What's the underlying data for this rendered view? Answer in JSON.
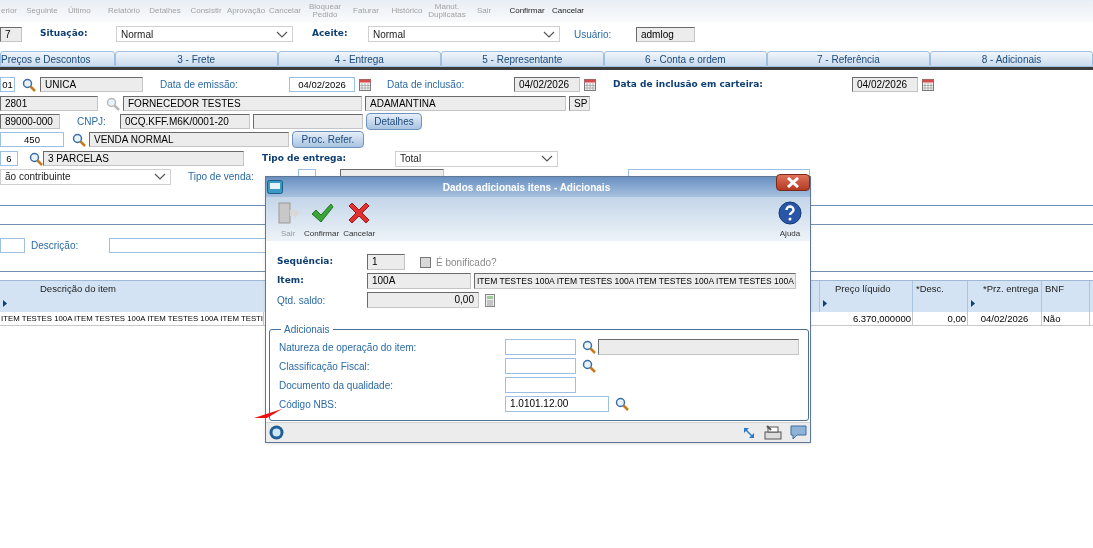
{
  "toolbar": [
    {
      "label": "erior",
      "disabled": true
    },
    {
      "label": "Seguinte",
      "disabled": true
    },
    {
      "label": "Último",
      "disabled": true
    },
    {
      "label": "Relatório",
      "disabled": true
    },
    {
      "label": "Detalhes",
      "disabled": true
    },
    {
      "label": "Consistir",
      "disabled": true
    },
    {
      "label": "Aprovação",
      "disabled": true
    },
    {
      "label": "Cancelar",
      "disabled": true
    },
    {
      "label": "Bloquear Pedido",
      "disabled": true
    },
    {
      "label": "Faturar",
      "disabled": true
    },
    {
      "label": "Histórico",
      "disabled": true
    },
    {
      "label": "Manut. Duplicatas",
      "disabled": true
    },
    {
      "label": "Sair",
      "disabled": true
    },
    {
      "label": "Confirmar",
      "disabled": false
    },
    {
      "label": "Cancelar",
      "disabled": false
    }
  ],
  "header_row": [
    {
      "kind": "readonly",
      "value": "7"
    },
    {
      "kind": "label_bold",
      "text": "Situação:"
    },
    {
      "kind": "select",
      "value": "Normal"
    },
    {
      "kind": "label_bold",
      "text": "Aceite:"
    },
    {
      "kind": "select",
      "value": "Normal"
    },
    {
      "kind": "label",
      "text": "Usuário:"
    },
    {
      "kind": "readonly",
      "value": "admlog"
    }
  ],
  "tabs": [
    {
      "label": "Preços e Descontos",
      "selected": false
    },
    {
      "label": "3 - Frete",
      "selected": false
    },
    {
      "label": "4 - Entrega",
      "selected": false
    },
    {
      "label": "5 - Representante",
      "selected": false
    },
    {
      "label": "6 - Conta e ordem",
      "selected": false
    },
    {
      "label": "7 - Referência",
      "selected": false
    },
    {
      "label": "8 - Adicionais",
      "selected": false
    }
  ],
  "form_rows": [
    [
      {
        "kind": "input",
        "value": "01"
      },
      {
        "kind": "search",
        "disabled": false
      },
      {
        "kind": "readonly",
        "value": "UNICA"
      },
      {
        "kind": "label",
        "text": "Data de emissão:"
      },
      {
        "kind": "input",
        "value": "04/02/2026"
      },
      {
        "kind": "calendar"
      },
      {
        "kind": "label",
        "text": "Data de inclusão:"
      },
      {
        "kind": "readonly",
        "value": "04/02/2026"
      },
      {
        "kind": "calendar"
      },
      {
        "kind": "label_bold",
        "text": "Data de inclusão em carteira:"
      },
      {
        "kind": "readonly",
        "value": "04/02/2026"
      },
      {
        "kind": "calendar"
      }
    ],
    [
      {
        "kind": "readonly",
        "value": "2801"
      },
      {
        "kind": "search",
        "disabled": true
      },
      {
        "kind": "readonly",
        "value": "FORNECEDOR TESTES"
      },
      {
        "kind": "readonly",
        "value": "ADAMANTINA"
      },
      {
        "kind": "readonly",
        "value": "SP"
      }
    ],
    [
      {
        "kind": "readonly",
        "value": "89000-000"
      },
      {
        "kind": "label",
        "text": "CNPJ:"
      },
      {
        "kind": "readonly",
        "value": "0CQ.KFF.M6K/0001-20"
      },
      {
        "kind": "readonly"
      },
      {
        "kind": "button",
        "text": "Detalhes"
      }
    ],
    [
      {
        "kind": "input",
        "value": "450"
      },
      {
        "kind": "search",
        "disabled": false
      },
      {
        "kind": "readonly",
        "value": "VENDA NORMAL"
      },
      {
        "kind": "button",
        "text": "Proc. Refer."
      }
    ],
    [
      {
        "kind": "input",
        "value": "6"
      },
      {
        "kind": "search",
        "disabled": false
      },
      {
        "kind": "readonly",
        "value": "3 PARCELAS"
      },
      {
        "kind": "label_bold",
        "text": "Tipo de entrega:"
      },
      {
        "kind": "select",
        "value": "Total"
      }
    ],
    [
      {
        "kind": "select",
        "value": "ão contribuinte"
      },
      {
        "kind": "label",
        "text": "Tipo de venda:"
      },
      {
        "kind": "input"
      },
      {
        "kind": "readonly"
      },
      {
        "kind": "input"
      }
    ]
  ],
  "filter_row": [
    {
      "kind": "input"
    },
    {
      "kind": "label",
      "text": "Descrição:"
    },
    {
      "kind": "input"
    }
  ],
  "table": {
    "columns": [
      {
        "label": "Descrição do item",
        "marker": true
      },
      {
        "label": "Preço líquido",
        "marker": true
      },
      {
        "label": "*Desc.",
        "marker": false
      },
      {
        "label": "*Prz. entrega",
        "marker": true
      },
      {
        "label": "BNF",
        "marker": false
      }
    ],
    "rows": [
      [
        "ITEM TESTES 100A ITEM TESTES 100A ITEM TESTES 100A ITEM TESTI",
        "6.370,000000",
        "0,00",
        "04/02/2026",
        "Não"
      ]
    ]
  },
  "dialog": {
    "title": "Dados adicionais itens - Adicionais",
    "toolbar": [
      {
        "kind": "exit",
        "label": "Sair",
        "disabled": true
      },
      {
        "kind": "confirm",
        "label": "Confirmar",
        "disabled": false
      },
      {
        "kind": "cancel",
        "label": "Cancelar",
        "disabled": false
      }
    ],
    "help": {
      "label": "Ajuda"
    },
    "sequencia": {
      "label": "Sequência:",
      "value": "1"
    },
    "bonificado": {
      "label": "É bonificado?",
      "checked": false
    },
    "item": {
      "label": "Item:",
      "code": "100A",
      "description": "ITEM TESTES 100A ITEM TESTES 100A ITEM TESTES 100A ITEM TESTES 100A"
    },
    "saldo": {
      "label": "Qtd. saldo:",
      "value": "0,00"
    },
    "group": {
      "legend": "Adicionais",
      "rows": [
        {
          "kind": "lookup_desc",
          "label": "Natureza de operação do item:"
        },
        {
          "kind": "lookup",
          "label": "Classificação Fiscal:"
        },
        {
          "kind": "plain",
          "label": "Documento da qualidade:"
        },
        {
          "kind": "lookup",
          "label": "Código NBS:",
          "value": "1.0101.12.00"
        }
      ]
    }
  }
}
